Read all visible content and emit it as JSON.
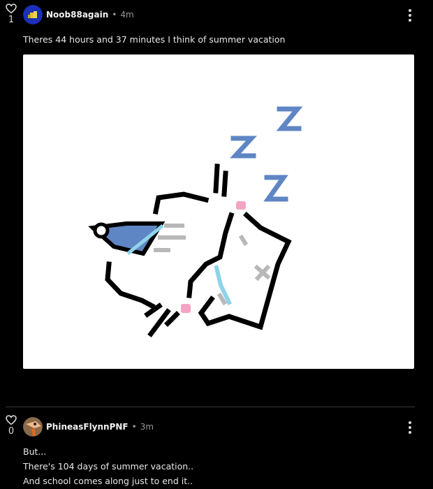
{
  "comments": [
    {
      "likes": "1",
      "username": "Noob88again",
      "time": "4m",
      "text": "Theres 44 hours and 37 minutes I think of summer vacation",
      "icons": {
        "like": "heart-outline-icon",
        "menu": "kebab-menu-icon"
      }
    },
    {
      "likes": "0",
      "username": "PhineasFlynnPNF",
      "time": "3m",
      "lines": [
        "But...",
        "There's 104 days of summer vacation..",
        "And school comes along just to end it.."
      ],
      "icons": {
        "like": "heart-outline-icon",
        "menu": "kebab-menu-icon"
      }
    }
  ],
  "attachment": {
    "sleep_letters": [
      "Z",
      "Z",
      "Z"
    ],
    "colors": {
      "background": "#ffffff",
      "outline": "#000000",
      "z_blue": "#5f86c4",
      "hat_blue": "#5f86c4",
      "cheek_pink": "#f2a5c3",
      "tear_blue": "#8fd3ea",
      "gray": "#b8b8b8"
    }
  },
  "theme": {
    "background": "#000000",
    "text": "#e8e8e8",
    "muted": "#9a9a9a",
    "divider": "#3a3a3a"
  }
}
